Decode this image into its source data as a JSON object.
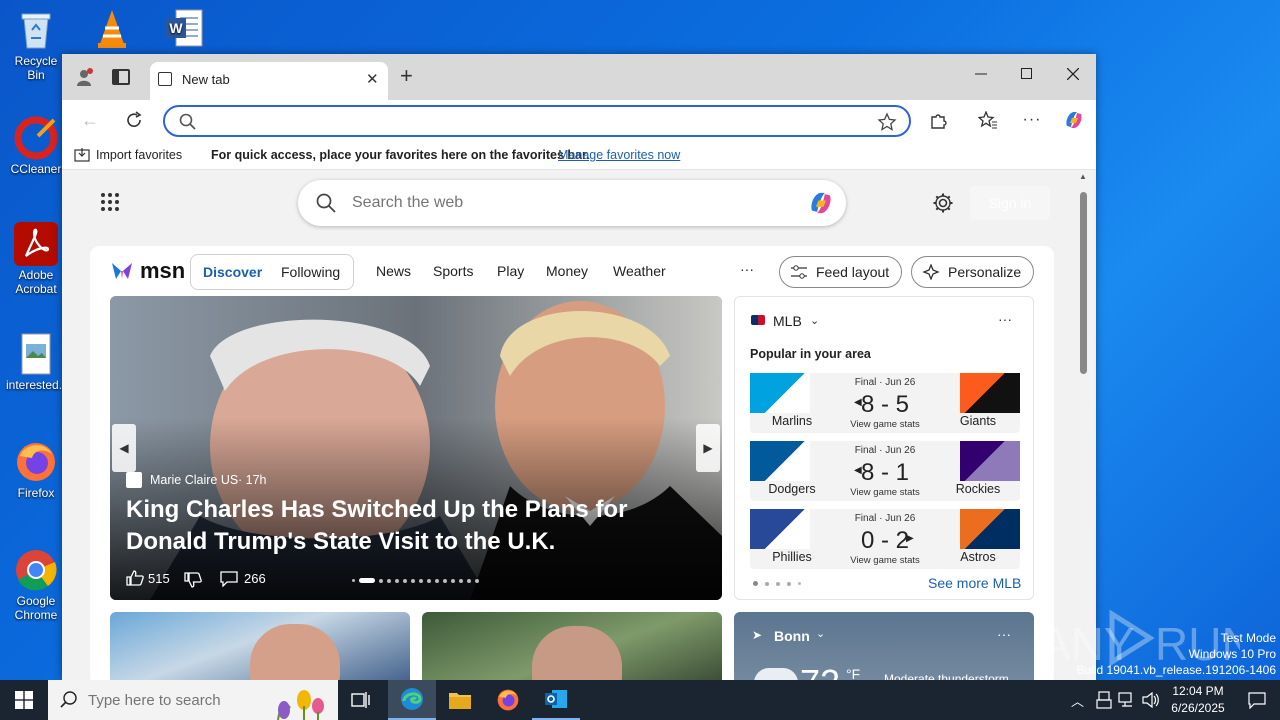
{
  "desktop": {
    "icons": [
      {
        "label": "Recycle Bin"
      },
      {
        "label": "CCleaner"
      },
      {
        "label": "Adobe Acrobat"
      },
      {
        "label": "interested..."
      },
      {
        "label": "Firefox"
      },
      {
        "label": "Google Chrome"
      }
    ]
  },
  "browser": {
    "tab_title": "New tab",
    "new_tab_label": "+",
    "address_value": "",
    "favbar": {
      "import_label": "Import favorites",
      "message": "For quick access, place your favorites here on the favorites bar.",
      "manage_link": "Manage favorites now"
    }
  },
  "newtab": {
    "search_placeholder": "Search the web",
    "signin_label": "Sign in"
  },
  "msn": {
    "logo": "msn",
    "tabs": [
      "Discover",
      "Following"
    ],
    "nav": [
      "News",
      "Sports",
      "Play",
      "Money",
      "Weather"
    ],
    "more_label": "···",
    "feed_layout": "Feed layout",
    "personalize": "Personalize",
    "hero": {
      "source": "Marie Claire US",
      "age": "· 17h",
      "headline": "King Charles Has Switched Up the Plans for Donald Trump's State Visit to the U.K.",
      "likes": "515",
      "comments": "266"
    },
    "mlb": {
      "title": "MLB",
      "subtitle": "Popular in your area",
      "see_more": "See more MLB",
      "games": [
        {
          "status": "Final · Jun 26",
          "home": "Marlins",
          "away": "Giants",
          "score": "8 - 5",
          "link": "View game stats",
          "home_color": "#00a3e0",
          "away_color": "#fd5a1e"
        },
        {
          "status": "Final · Jun 26",
          "home": "Dodgers",
          "away": "Rockies",
          "score": "8 - 1",
          "link": "View game stats",
          "home_color": "#005a9c",
          "away_color": "#33006f"
        },
        {
          "status": "Final · Jun 26",
          "home": "Phillies",
          "away": "Astros",
          "score": "0 - 2",
          "link": "View game stats",
          "home_color": "#e81828",
          "away_color": "#002d62"
        }
      ]
    },
    "weather": {
      "location": "Bonn",
      "temp": "72",
      "unit": "°F",
      "alert": "Moderate thunderstorm warning"
    }
  },
  "taskbar": {
    "search_placeholder": "Type here to search",
    "time": "12:04 PM",
    "date": "6/26/2025"
  },
  "watermark": {
    "line1": "Test Mode",
    "line2": "Windows 10 Pro",
    "line3": "Build 19041.vb_release.191206-1406"
  }
}
